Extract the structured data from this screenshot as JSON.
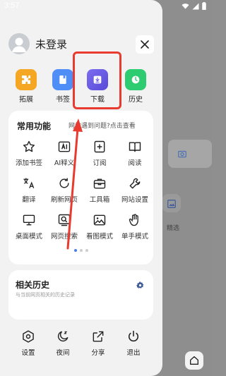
{
  "status_bar": {
    "time": "3:57"
  },
  "background": {
    "item_label": "精选"
  },
  "profile": {
    "login_text": "未登录"
  },
  "quick_actions": [
    {
      "label": "拓展",
      "icon": "puzzle-icon",
      "color": "#f5a623"
    },
    {
      "label": "书签",
      "icon": "bookmark-icon",
      "color": "#4f8ef7"
    },
    {
      "label": "下载",
      "icon": "download-icon",
      "color": "#6c5ce7"
    },
    {
      "label": "历史",
      "icon": "history-clock-icon",
      "color": "#2ecc71"
    }
  ],
  "common": {
    "title": "常用功能",
    "help_link": "网站遇到问题?点击查看",
    "items": [
      {
        "label": "添加书签",
        "icon": "star-icon"
      },
      {
        "label": "AI释义",
        "icon": "ai-icon"
      },
      {
        "label": "订阅",
        "icon": "add-square-icon"
      },
      {
        "label": "阅读",
        "icon": "book-icon"
      },
      {
        "label": "翻译",
        "icon": "translate-icon"
      },
      {
        "label": "刷新网页",
        "icon": "refresh-icon"
      },
      {
        "label": "工具箱",
        "icon": "toolbox-icon"
      },
      {
        "label": "网站设置",
        "icon": "wrench-icon"
      },
      {
        "label": "桌面模式",
        "icon": "monitor-icon"
      },
      {
        "label": "网页搜索",
        "icon": "page-search-icon"
      },
      {
        "label": "看图模式",
        "icon": "image-icon"
      },
      {
        "label": "单手模式",
        "icon": "hand-icon"
      }
    ],
    "page_indicator": {
      "current": 1,
      "total": 3
    }
  },
  "history": {
    "title": "相关历史",
    "subtitle": "与当前网页相关的历史记录"
  },
  "bottom_bar": [
    {
      "label": "设置",
      "icon": "settings-hex-icon"
    },
    {
      "label": "夜间",
      "icon": "moon-icon"
    },
    {
      "label": "分享",
      "icon": "share-icon"
    },
    {
      "label": "退出",
      "icon": "power-icon"
    }
  ],
  "colors": {
    "accent": "#4a7cf0",
    "highlight": "#e83a2f"
  }
}
